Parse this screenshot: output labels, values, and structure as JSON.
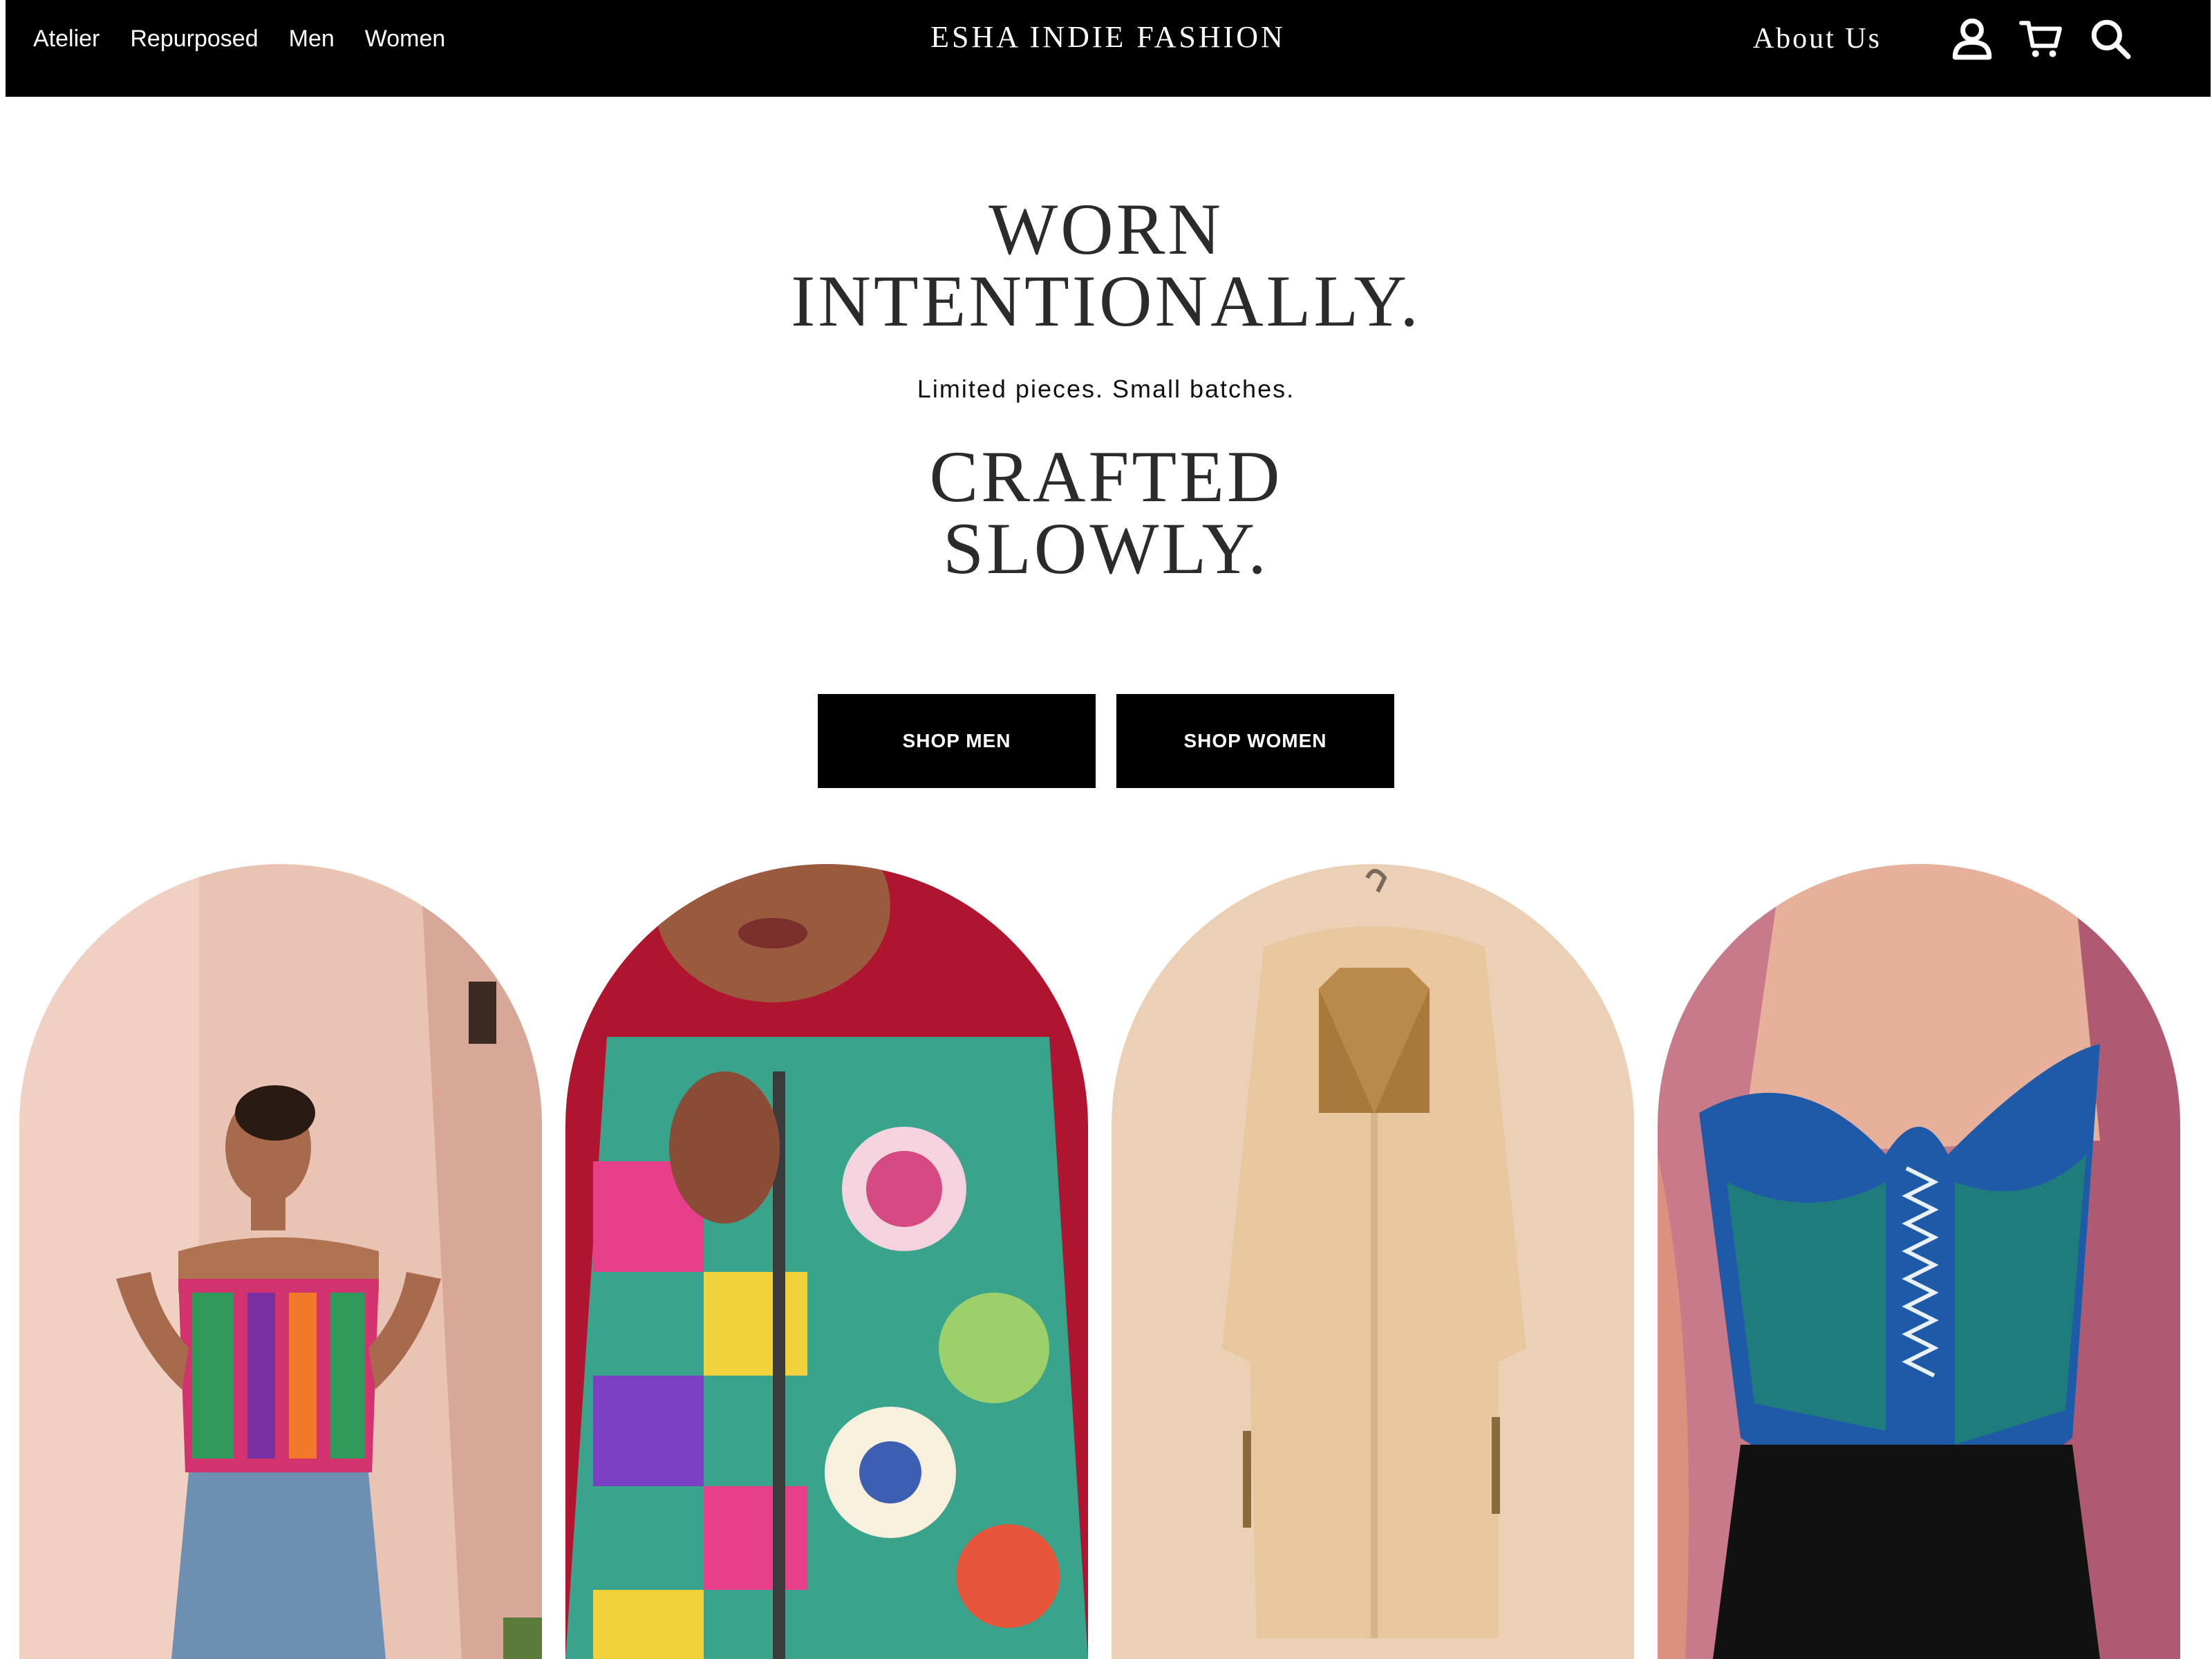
{
  "nav": {
    "links": [
      "Atelier",
      "Repurposed",
      "Men",
      "Women"
    ],
    "brand": "ESHA INDIE FASHION",
    "about": "About Us",
    "icons": [
      "account-icon",
      "cart-icon",
      "search-icon"
    ]
  },
  "hero": {
    "headline_1": [
      "WORN",
      "INTENTIONALLY."
    ],
    "subtitle": "Limited pieces. Small batches.",
    "headline_2": [
      "CRAFTED",
      "SLOWLY."
    ]
  },
  "buttons": {
    "shop_men": "SHOP MEN",
    "shop_women": "SHOP WOMEN"
  },
  "colors": {
    "nav_bg": "#000000",
    "nav_text": "#ffffff",
    "heading_text": "#2b2b2b",
    "button_bg": "#000000",
    "button_text": "#ffffff"
  }
}
